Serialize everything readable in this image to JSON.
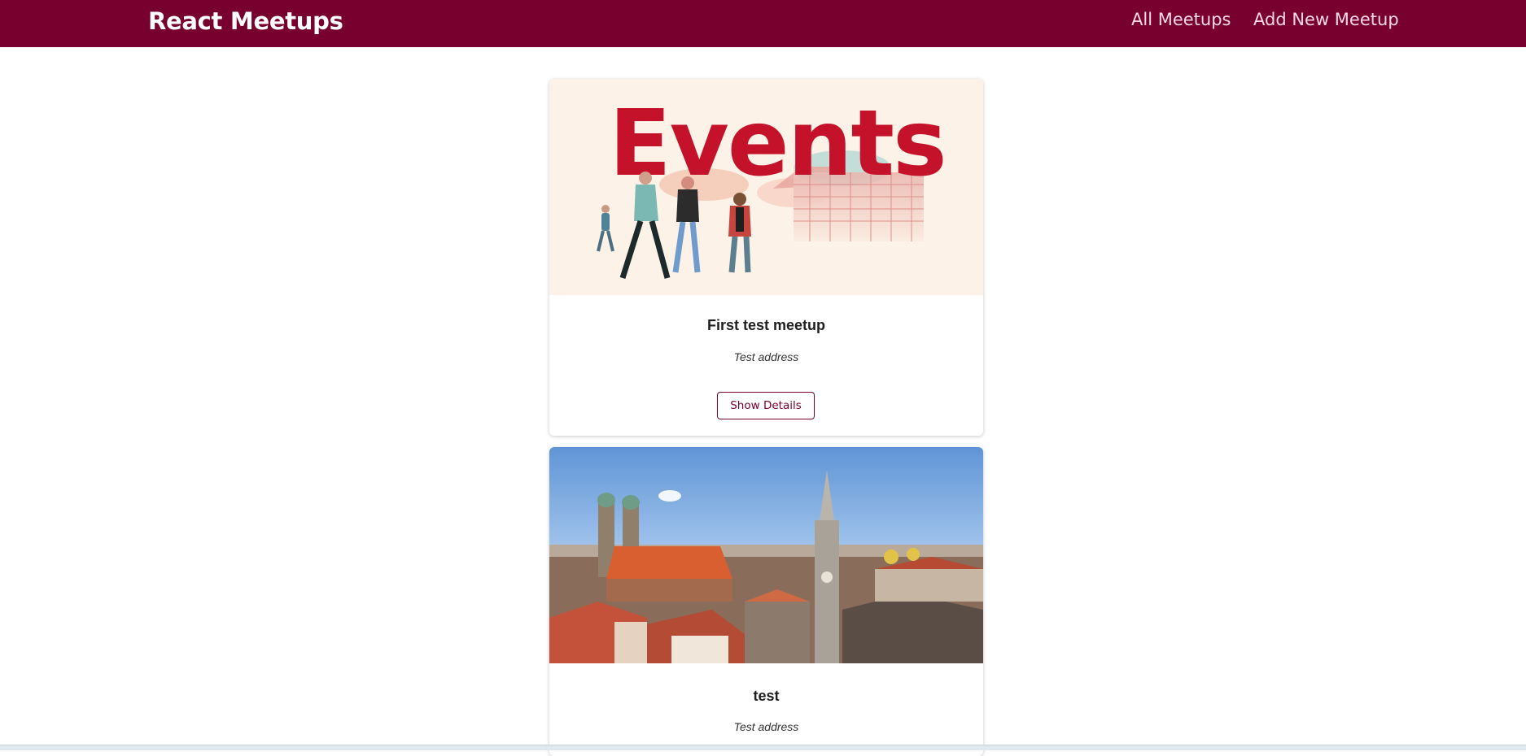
{
  "header": {
    "logo": "React Meetups",
    "nav": [
      "All Meetups",
      "Add New Meetup"
    ]
  },
  "meetups": [
    {
      "image_text": "Events",
      "title": "First test meetup",
      "address": "Test address",
      "button": "Show Details"
    },
    {
      "title": "test",
      "address": "Test address"
    }
  ],
  "colors": {
    "brand": "#77002e",
    "nav_text": "#fcd9e6",
    "events_red": "#c5122b"
  }
}
